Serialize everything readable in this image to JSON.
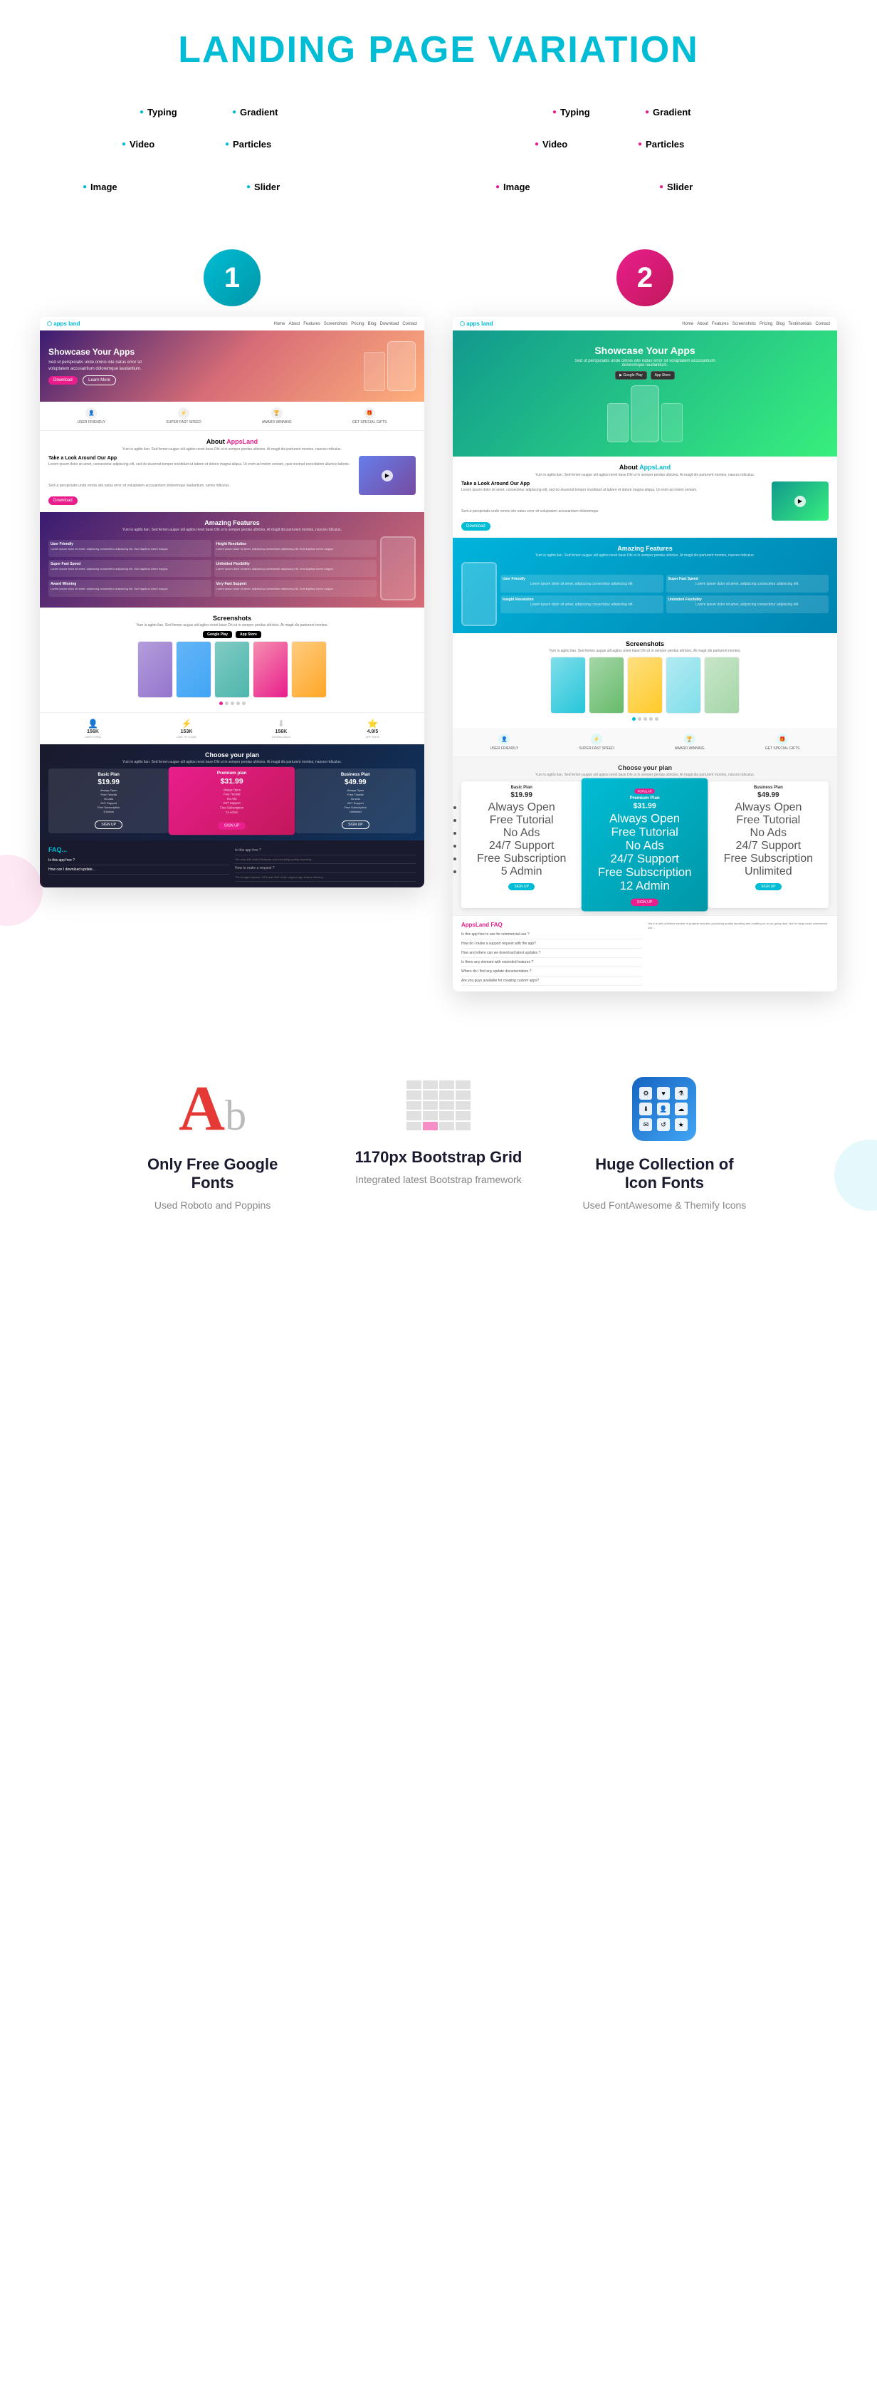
{
  "page": {
    "title": "LANDING PAGE",
    "title_accent": "VARIATION"
  },
  "variations": [
    {
      "number": "1",
      "tags": [
        "Typing",
        "Gradient",
        "Video",
        "Particles",
        "Image",
        "Slider"
      ],
      "hero_title": "Showcase Your Apps",
      "hero_desc": "Sed ut perspiciatis unde omnis iste natus error sit voluptatem accusantium doloremque laudantium.",
      "btn_download": "Download",
      "btn_learn": "Learn More",
      "about_title": "About AppsLand",
      "about_desc": "Yum is agitto ilan. Sed femen augue util agitos renet base Dhi ut in semper perdas ultricies. At magit dis parturent montes, nasces ridiculus.",
      "about_sub": "Take a Look Around Our App",
      "amazing_title": "Amazing Features",
      "screenshots_title": "Screenshots",
      "pricing_title": "Choose your plan",
      "faq_title": "FAQ",
      "stats": [
        {
          "num": "156K",
          "label": "USER USED"
        },
        {
          "num": "153K",
          "label": "LINE OF CODE"
        },
        {
          "num": "156K",
          "label": "DOWNLOADS"
        },
        {
          "num": "4.9/5",
          "label": "APP RATE"
        }
      ],
      "plans": [
        {
          "name": "Basic Plan",
          "price": "$19.99"
        },
        {
          "name": "Premium plan",
          "price": "$31.99",
          "featured": true
        },
        {
          "name": "Business Plan",
          "price": "$49.99"
        }
      ]
    },
    {
      "number": "2",
      "tags": [
        "Typing",
        "Gradient",
        "Video",
        "Particles",
        "Image",
        "Slider"
      ],
      "hero_title": "Showcase Your Apps",
      "hero_desc": "Sed ut perspiciatis unde omnis iste natus error sit voluptatem accusantium doloremque laudantium.",
      "about_title": "About AppsLand",
      "amazing_title": "Amazing Features",
      "screenshots_title": "Screenshots",
      "pricing_title": "Choose your plan",
      "faq_title": "AppsLand FAQ",
      "plans": [
        {
          "name": "Basic Plan",
          "price": "$19.99"
        },
        {
          "name": "Premium Plan",
          "price": "$31.99",
          "featured": true
        },
        {
          "name": "Business Plan",
          "price": "$49.99"
        }
      ]
    }
  ],
  "bottom_features": [
    {
      "icon_type": "letter",
      "title": "Only Free Google Fonts",
      "desc": "Used Roboto and Poppins"
    },
    {
      "icon_type": "grid",
      "title": "1170px Bootstrap Grid",
      "desc": "Integrated latest Bootstrap framework"
    },
    {
      "icon_type": "icons",
      "title": "Huge Collection of Icon Fonts",
      "desc": "Used FontAwesome & Themify Icons"
    }
  ]
}
